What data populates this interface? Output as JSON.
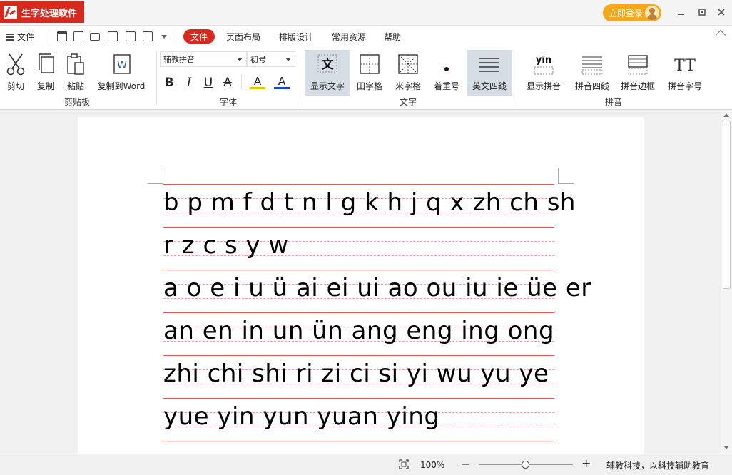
{
  "app": {
    "title": "生字处理软件",
    "login_label": "立即登录"
  },
  "menu": {
    "file_label": "文件",
    "tabs": [
      {
        "label": "文件",
        "active": true
      },
      {
        "label": "页面布局",
        "active": false
      },
      {
        "label": "排版设计",
        "active": false
      },
      {
        "label": "常用资源",
        "active": false
      },
      {
        "label": "帮助",
        "active": false
      }
    ]
  },
  "ribbon": {
    "clipboard": {
      "label": "剪贴板",
      "buttons": [
        "剪切",
        "复制",
        "粘贴",
        "复制到Word"
      ],
      "word_glyph": "W"
    },
    "font": {
      "label": "字体",
      "font_name": "辅教拼音",
      "font_size": "初号",
      "bold": "B",
      "italic": "I",
      "underline": "U",
      "strike": "A",
      "highlight_glyph": "A",
      "color_glyph": "A"
    },
    "text": {
      "label": "文字",
      "buttons": [
        "显示文字",
        "田字格",
        "米字格",
        "着重号",
        "英文四线"
      ],
      "show_text_glyph": "文",
      "emphasis_glyph": "•"
    },
    "pinyin": {
      "label": "拼音",
      "buttons": [
        "显示拼音",
        "拼音四线",
        "拼音边框",
        "拼音字号"
      ],
      "show_pinyin_glyph": "yīn",
      "size_glyph": "TT"
    }
  },
  "document": {
    "lines": [
      "b p m f d t n l g k h j q x zh ch sh",
      " r z c s y w",
      "a o e i u ü ai ei ui ao ou iu ie üe er",
      "an en in un ün ang eng ing ong",
      "zhi chi shi ri  zi ci si  yi wu yu  ye",
      "yue yin yun yuan ying"
    ],
    "line_color": "#e05555"
  },
  "status": {
    "zoom": "100%",
    "zoom_minus": "−",
    "zoom_plus": "+",
    "zoom_level": 0.5,
    "footer_text": "辅教科技，以科技辅助教育"
  },
  "colors": {
    "brand": "#d9281e",
    "login": "#f5a81c"
  }
}
